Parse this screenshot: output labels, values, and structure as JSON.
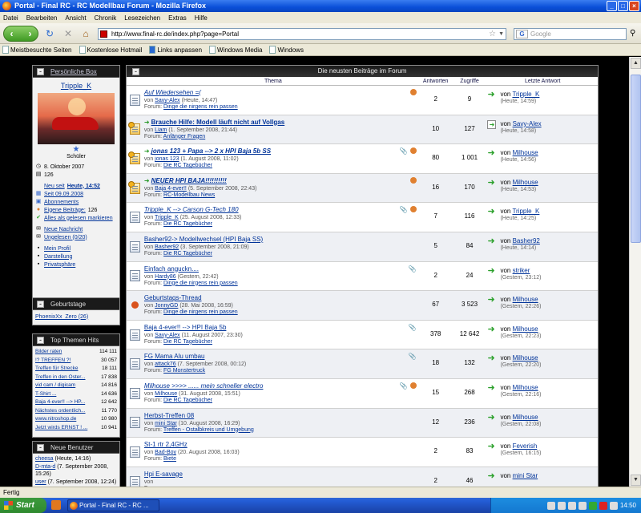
{
  "window": {
    "title": "Portal - Final RC - RC Modellbau Forum - Mozilla Firefox"
  },
  "menu": [
    "Datei",
    "Bearbeiten",
    "Ansicht",
    "Chronik",
    "Lesezeichen",
    "Extras",
    "Hilfe"
  ],
  "nav": {
    "url": "http://www.final-rc.de/index.php?page=Portal",
    "search_placeholder": "Google"
  },
  "bookmarks": [
    "Meistbesuchte Seiten",
    "Kostenlose Hotmail",
    "Links anpassen",
    "Windows Media",
    "Windows"
  ],
  "profile": {
    "title": "Persönliche Box",
    "username": "Tripple_K",
    "rank": "Schüler",
    "joined": "8. Oktober 2007",
    "posts": "126",
    "new_since_label": "Neu seit",
    "new_since_today": "Heute, 14:52",
    "since_date": "Seit 09.09.2008",
    "subscriptions": "Abonnements",
    "own_posts_label": "Eigene Beiträge:",
    "own_posts": "126",
    "mark_read": "Alles als gelesen markieren",
    "new_message": "Neue Nachricht",
    "unread": "Ungelesen (0/20)",
    "my_profile": "Mein Profil",
    "display": "Darstellung",
    "privacy": "Privatsphäre"
  },
  "birthdays": {
    "title": "Geburtstage",
    "entry": "PhoenixXx_Zero (26)"
  },
  "top_topics": {
    "title": "Top Themen Hits",
    "items": [
      {
        "name": "Bilder raten",
        "count": "114 111"
      },
      {
        "name": "!? TREFFEN ?!",
        "count": "30 057"
      },
      {
        "name": "Treffen für Strecke",
        "count": "18 111"
      },
      {
        "name": "Treffen in den Oster...",
        "count": "17 838"
      },
      {
        "name": "vid cam / digicam",
        "count": "14 816"
      },
      {
        "name": "T-Shirt ...",
        "count": "14 636"
      },
      {
        "name": "Baja 4-ever!! --> HP...",
        "count": "12 642"
      },
      {
        "name": "Nächstes ordentlich...",
        "count": "11 770"
      },
      {
        "name": "www.nitroshop.de",
        "count": "10 980"
      },
      {
        "name": "Jetzt wirds ERNST ! ...",
        "count": "10 941"
      }
    ]
  },
  "new_users": {
    "title": "Neue Benutzer",
    "items": [
      {
        "name": "cheesa",
        "date": "(Heute, 14:16)"
      },
      {
        "name": "D-mta-d",
        "date": "(7. September 2008, 15:26)"
      },
      {
        "name": "user",
        "date": "(7. September 2008, 12:24)"
      }
    ]
  },
  "forum": {
    "title": "Die neusten Beiträge im Forum",
    "columns": {
      "topic": "Thema",
      "replies": "Antworten",
      "views": "Zugriffe",
      "last": "Letzte Antwort"
    },
    "by": "von",
    "forum_label": "Forum:",
    "rows": [
      {
        "title": "Auf Wiedersehen =(",
        "style": "i",
        "icon": "normal",
        "new": false,
        "att": false,
        "usr": true,
        "author": "Savy-Alex",
        "date": "(Heute, 14:47)",
        "forum": "Dinge die nirgens rein passen",
        "replies": "2",
        "views": "9",
        "last_user": "Tripple_K",
        "last_date": "(Heute, 14:59)",
        "last_icon": "arrow"
      },
      {
        "title": "Brauche Hilfe: Modell läuft nicht auf Vollgas",
        "style": "b",
        "icon": "hot",
        "new": true,
        "att": false,
        "usr": false,
        "author": "Liam",
        "date": "(1. September 2008, 21:44)",
        "forum": "Anfänger Fragen",
        "replies": "10",
        "views": "127",
        "last_user": "Savy-Alex",
        "last_date": "(Heute, 14:58)",
        "last_icon": "box"
      },
      {
        "title": "jonas 123 + Papa --> 2 x HPI Baja 5b SS",
        "style": "bi",
        "icon": "hot",
        "new": true,
        "att": true,
        "usr": true,
        "author": "jonas 123",
        "date": "(1. August 2008, 11:02)",
        "forum": "Die RC Tagebücher",
        "replies": "80",
        "views": "1 001",
        "last_user": "Milhouse",
        "last_date": "(Heute, 14:56)",
        "last_icon": "arrow"
      },
      {
        "title": "NEUER HPI BAJA!!!!!!!!!!",
        "style": "bi",
        "icon": "hot",
        "new": true,
        "att": false,
        "usr": true,
        "author": "Baja 4-ever!!",
        "date": "(5. September 2008, 22:43)",
        "forum": "RC-Modellbau News",
        "replies": "16",
        "views": "170",
        "last_user": "Milhouse",
        "last_date": "(Heute, 14:53)",
        "last_icon": "arrow"
      },
      {
        "title": "Tripple_K --> Carson G-Tech 180",
        "style": "i",
        "icon": "normal",
        "new": false,
        "att": true,
        "usr": true,
        "author": "Tripple_K",
        "date": "(25. August 2008, 12:33)",
        "forum": "Die RC Tagebücher",
        "replies": "7",
        "views": "116",
        "last_user": "Tripple_K",
        "last_date": "(Heute, 14:25)",
        "last_icon": "arrow"
      },
      {
        "title": "Basher92-> Modellwechsel (HPI Baja SS)",
        "style": "",
        "icon": "normal",
        "new": false,
        "att": false,
        "usr": false,
        "author": "Basher92",
        "date": "(3. September 2008, 21:09)",
        "forum": "Die RC Tagebücher",
        "replies": "5",
        "views": "84",
        "last_user": "Basher92",
        "last_date": "(Heute, 14:14)",
        "last_icon": "arrow"
      },
      {
        "title": "Einfach anguckn....",
        "style": "",
        "icon": "normal",
        "new": false,
        "att": true,
        "usr": false,
        "author": "Hardy86",
        "date": "(Gestern, 22:42)",
        "forum": "Dinge die nirgens rein passen",
        "replies": "2",
        "views": "24",
        "last_user": "striker",
        "last_date": "(Gestern, 23:12)",
        "last_icon": "arrow"
      },
      {
        "title": "Geburtstags-Thread",
        "style": "",
        "icon": "poll",
        "new": false,
        "att": false,
        "usr": false,
        "author": "JonnyGD",
        "date": "(28. Mai 2008, 16:59)",
        "forum": "Dinge die nirgens rein passen",
        "replies": "67",
        "views": "3 523",
        "last_user": "Milhouse",
        "last_date": "(Gestern, 22:26)",
        "last_icon": "arrow"
      },
      {
        "title": "Baja 4-ever!! --> HPI Baja 5b",
        "style": "",
        "icon": "normal",
        "new": false,
        "att": true,
        "usr": false,
        "author": "Savy-Alex",
        "date": "(11. August 2007, 23:30)",
        "forum": "Die RC Tagebücher",
        "replies": "378",
        "views": "12 642",
        "last_user": "Milhouse",
        "last_date": "(Gestern, 22:23)",
        "last_icon": "arrow"
      },
      {
        "title": "FG Mama Alu umbau",
        "style": "",
        "icon": "normal",
        "new": false,
        "att": true,
        "usr": false,
        "author": "attack76",
        "date": "(7. September 2008, 00:12)",
        "forum": "FG Monstertruck",
        "replies": "18",
        "views": "132",
        "last_user": "Milhouse",
        "last_date": "(Gestern, 22:20)",
        "last_icon": "arrow"
      },
      {
        "title": "Milhouse >>>> ...... mein schneller electro",
        "style": "i",
        "icon": "normal",
        "new": false,
        "att": true,
        "usr": true,
        "author": "Milhouse",
        "date": "(31. August 2008, 15:51)",
        "forum": "Die RC Tagebücher",
        "replies": "15",
        "views": "268",
        "last_user": "Milhouse",
        "last_date": "(Gestern, 22:16)",
        "last_icon": "arrow"
      },
      {
        "title": "Herbst-Treffen 08",
        "style": "",
        "icon": "normal",
        "new": false,
        "att": false,
        "usr": false,
        "author": "mini Star",
        "date": "(10. August 2008, 16:29)",
        "forum": "Treffen - Ostalbkreis und Umgebung",
        "replies": "12",
        "views": "236",
        "last_user": "Milhouse",
        "last_date": "(Gestern, 22:08)",
        "last_icon": "arrow"
      },
      {
        "title": "St-1 rtr 2,4GHz",
        "style": "",
        "icon": "normal",
        "new": false,
        "att": false,
        "usr": false,
        "author": "Bad-Boy",
        "date": "(20. August 2008, 16:03)",
        "forum": "Biete",
        "replies": "2",
        "views": "83",
        "last_user": "Feverish",
        "last_date": "(Gestern, 16:15)",
        "last_icon": "arrow"
      },
      {
        "title": "Hpi E-savage",
        "style": "",
        "icon": "normal",
        "new": false,
        "att": false,
        "usr": false,
        "author": "",
        "date": "",
        "forum": "",
        "replies": "2",
        "views": "46",
        "last_user": "mini Star",
        "last_date": "",
        "last_icon": "arrow"
      }
    ]
  },
  "status": "Fertig",
  "taskbar": {
    "start": "Start",
    "item": "Portal - Final RC - RC ...",
    "clock": "14:50"
  }
}
